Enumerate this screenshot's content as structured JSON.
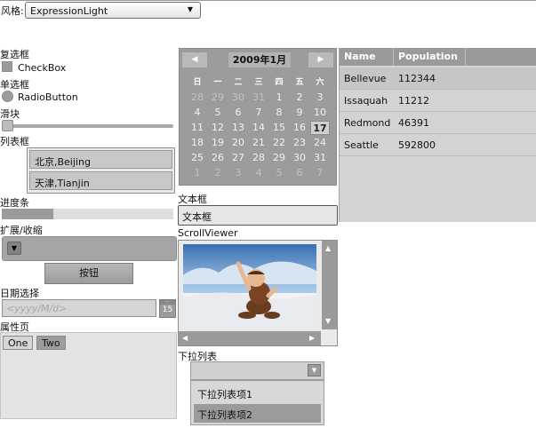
{
  "theme": {
    "label": "风格:",
    "selected": "ExpressionLight"
  },
  "checkbox": {
    "heading": "复选框",
    "label": "CheckBox",
    "checked": false
  },
  "radio": {
    "heading": "单选框",
    "label": "RadioButton",
    "checked": false
  },
  "slider": {
    "heading": "滑块",
    "value": 0
  },
  "listbox": {
    "heading": "列表框",
    "items": [
      "北京,Beijing",
      "天津,Tianjin"
    ]
  },
  "progress": {
    "heading": "进度条",
    "value": 0.3
  },
  "expander": {
    "heading": "扩展/收缩",
    "expanded": false
  },
  "button": {
    "label": "按钮"
  },
  "datepicker": {
    "heading": "日期选择",
    "placeholder": "<yyyy/M/d>",
    "icon_day": "15"
  },
  "tabs": {
    "heading": "属性页",
    "items": [
      "One",
      "Two"
    ],
    "selected": "Two"
  },
  "calendar": {
    "title": "2009年1月",
    "prev": "◀",
    "next": "▶",
    "weekdays": [
      "日",
      "一",
      "二",
      "三",
      "四",
      "五",
      "六"
    ],
    "days": [
      [
        "28",
        "29",
        "30",
        "31",
        "1",
        "2",
        "3"
      ],
      [
        "4",
        "5",
        "6",
        "7",
        "8",
        "9",
        "10"
      ],
      [
        "11",
        "12",
        "13",
        "14",
        "15",
        "16",
        "17"
      ],
      [
        "18",
        "19",
        "20",
        "21",
        "22",
        "23",
        "24"
      ],
      [
        "25",
        "26",
        "27",
        "28",
        "29",
        "30",
        "31"
      ],
      [
        "1",
        "2",
        "3",
        "4",
        "5",
        "6",
        "7"
      ]
    ],
    "today": "17"
  },
  "textbox": {
    "heading": "文本框",
    "value": "文本框"
  },
  "scrollviewer": {
    "heading": "ScrollViewer"
  },
  "dropdown": {
    "heading": "下拉列表",
    "items": [
      "下拉列表项1",
      "下拉列表项2"
    ],
    "selected": "下拉列表项2"
  },
  "grid": {
    "columns": [
      "Name",
      "Population"
    ],
    "rows": [
      [
        "Bellevue",
        "112344"
      ],
      [
        "Issaquah",
        "11212"
      ],
      [
        "Redmond",
        "46391"
      ],
      [
        "Seattle",
        "592800"
      ]
    ]
  }
}
